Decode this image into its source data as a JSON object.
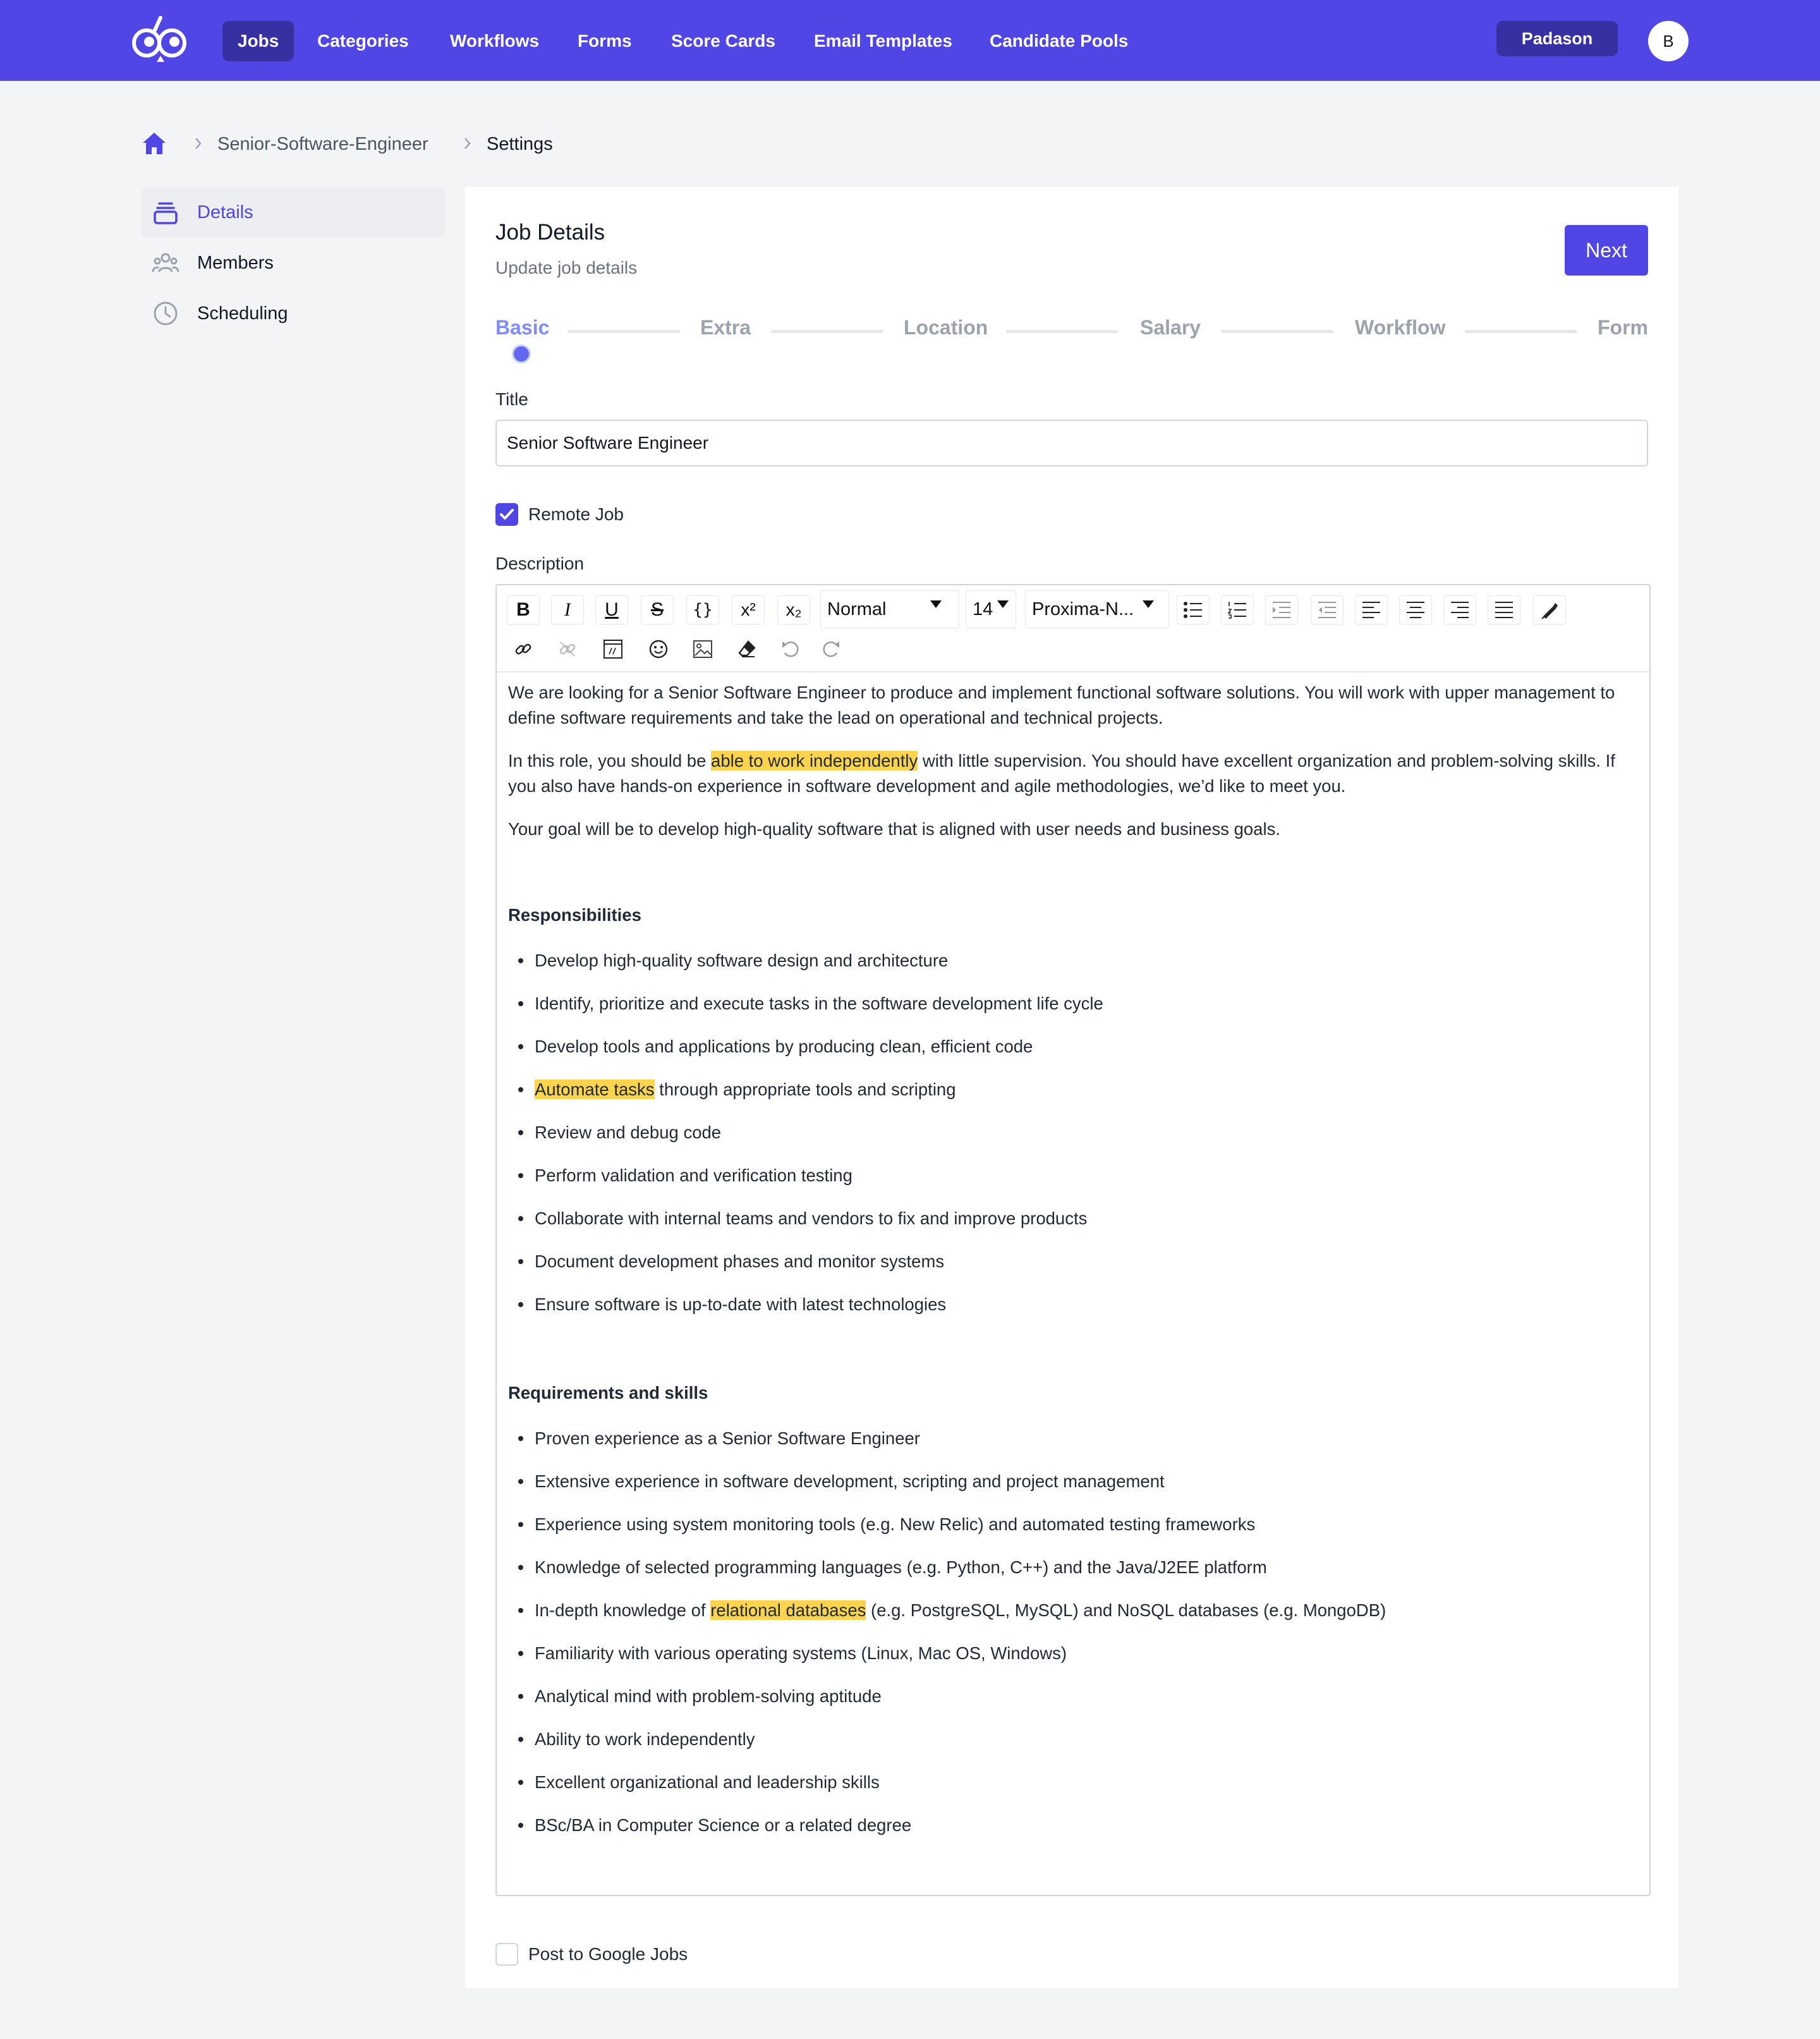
{
  "nav": {
    "items": [
      "Jobs",
      "Categories",
      "Workflows",
      "Forms",
      "Score Cards",
      "Email Templates",
      "Candidate Pools"
    ],
    "active": "Jobs",
    "org_button": "Padason",
    "avatar_initial": "B"
  },
  "breadcrumb": {
    "items": [
      "Senior-Software-Engineer",
      "Settings"
    ]
  },
  "sidebar": {
    "items": [
      {
        "label": "Details",
        "icon": "briefcase-icon",
        "active": true
      },
      {
        "label": "Members",
        "icon": "users-icon",
        "active": false
      },
      {
        "label": "Scheduling",
        "icon": "clock-icon",
        "active": false
      }
    ]
  },
  "card": {
    "title": "Job Details",
    "subtitle": "Update job details",
    "next_label": "Next"
  },
  "stepper": {
    "steps": [
      "Basic",
      "Extra",
      "Location",
      "Salary",
      "Workflow",
      "Form"
    ],
    "active_index": 0
  },
  "form": {
    "title_label": "Title",
    "title_value": "Senior Software Engineer",
    "remote_label": "Remote Job",
    "remote_checked": true,
    "description_label": "Description",
    "google_jobs_label": "Post to Google Jobs",
    "google_jobs_checked": false
  },
  "editor": {
    "toolbar": {
      "heading_select": "Normal",
      "size_select": "14",
      "font_select": "Proxima-N..."
    },
    "intro": {
      "p1": "We are looking for a Senior Software Engineer to produce and implement functional software solutions. You will work with upper management to define software requirements and take the lead on operational and technical projects.",
      "p2_before": "In this role, you should be ",
      "p2_highlight": "able to work independently",
      "p2_after": " with little supervision. You should have excellent organization and problem-solving skills. If you also have hands-on experience in software development and agile methodologies, we’d like to meet you.",
      "p3": "Your goal will be to develop high-quality software that is aligned with user needs and business goals."
    },
    "responsibilities": {
      "heading": "Responsibilities",
      "items": [
        "Develop high-quality software design and architecture",
        "Identify, prioritize and execute tasks in the software development life cycle",
        "Develop tools and applications by producing clean, efficient code",
        "Review and debug code",
        "Perform validation and verification testing",
        "Collaborate with internal teams and vendors to fix and improve products",
        "Document development phases and monitor systems",
        "Ensure software is up-to-date with latest technologies"
      ],
      "highlight_item": {
        "highlight": "Automate tasks",
        "rest": " through appropriate tools and scripting"
      }
    },
    "requirements": {
      "heading": "Requirements and skills",
      "items": [
        "Proven experience as a Senior Software Engineer",
        "Extensive experience in software development, scripting and project management",
        "Experience using system monitoring tools (e.g. New Relic) and automated testing frameworks",
        "Knowledge of selected programming languages (e.g. Python, C++) and the Java/J2EE platform",
        "Familiarity with various operating systems (Linux, Mac OS, Windows)",
        "Analytical mind with problem-solving aptitude",
        "Ability to work independently",
        "Excellent organizational and leadership skills",
        "BSc/BA in Computer Science or a related degree"
      ],
      "highlight_item": {
        "before": "In-depth knowledge of ",
        "highlight": "relational databases",
        "rest": " (e.g. PostgreSQL, MySQL) and NoSQL databases (e.g. MongoDB)"
      }
    }
  },
  "colors": {
    "brand": "#4f46e5",
    "brand_dark": "#3730a3",
    "highlight": "#fcd34d"
  }
}
